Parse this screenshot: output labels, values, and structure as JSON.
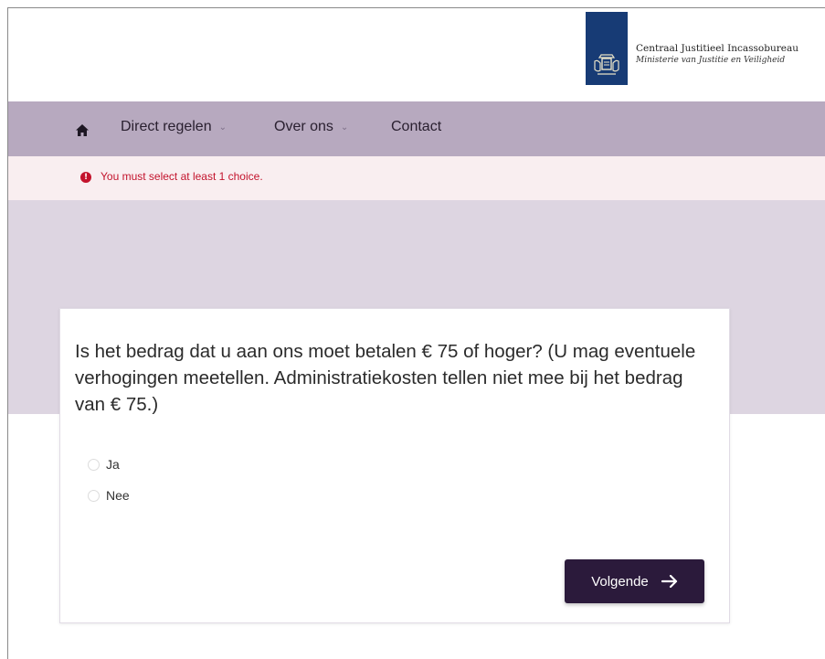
{
  "header": {
    "org_name": "Centraal Justitieel Incassobureau",
    "org_subtitle": "Ministerie van Justitie en Veiligheid",
    "logo_icon": "coat-of-arms-icon",
    "brand_color": "#173b75"
  },
  "nav": {
    "home_icon": "home-icon",
    "items": [
      {
        "label": "Direct regelen",
        "has_dropdown": true
      },
      {
        "label": "Over ons",
        "has_dropdown": true
      },
      {
        "label": "Contact",
        "has_dropdown": false
      }
    ],
    "background": "#b7a9bf"
  },
  "alert": {
    "icon": "error-icon",
    "message": "You must select at least 1 choice.",
    "color": "#c3132c"
  },
  "form": {
    "question": "Is het bedrag dat u aan ons moet betalen € 75 of hoger? (U mag eventuele verhogingen meetellen. Administratiekosten tellen niet mee bij het bedrag van € 75.)",
    "options": [
      {
        "label": "Ja",
        "selected": false
      },
      {
        "label": "Nee",
        "selected": false
      }
    ],
    "next_button": {
      "label": "Volgende",
      "icon": "arrow-right-icon",
      "color": "#2b1a3b"
    }
  }
}
